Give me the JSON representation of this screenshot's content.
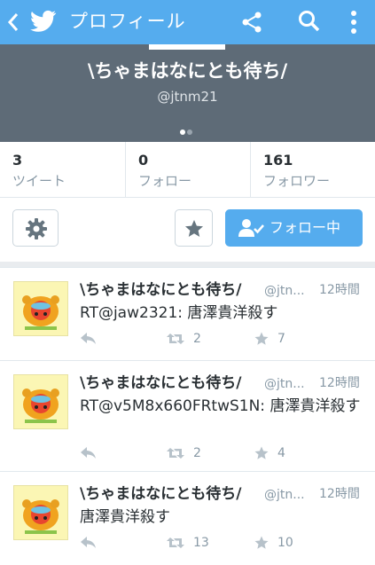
{
  "header": {
    "title": "プロフィール"
  },
  "profile": {
    "name": "\\ちゃまはなにとも待ち/",
    "handle": "@jtnm21"
  },
  "stats": [
    {
      "count": "3",
      "label": "ツイート"
    },
    {
      "count": "0",
      "label": "フォロー"
    },
    {
      "count": "161",
      "label": "フォロワー"
    }
  ],
  "actions": {
    "follow_label": "フォロー中"
  },
  "tweets": [
    {
      "name": "\\ちゃまはなにとも待ち/",
      "handle": "@jtn...",
      "time": "12時間",
      "text": "RT@jaw2321: 唐澤貴洋殺す",
      "retweets": "2",
      "favorites": "7"
    },
    {
      "name": "\\ちゃまはなにとも待ち/",
      "handle": "@jtn...",
      "time": "12時間",
      "text": "RT@v5M8x660FRtwS1N: 唐澤貴洋殺す",
      "retweets": "2",
      "favorites": "4"
    },
    {
      "name": "\\ちゃまはなにとも待ち/",
      "handle": "@jtn...",
      "time": "12時間",
      "text": "唐澤貴洋殺す",
      "retweets": "13",
      "favorites": "10"
    }
  ],
  "colors": {
    "brand": "#55acee",
    "banner": "#5e6b77",
    "muted": "#8899a6",
    "text": "#292f33"
  },
  "icons": {
    "back": "chevron-left-icon",
    "logo": "twitter-bird-icon",
    "share": "share-icon",
    "search": "search-icon",
    "more": "more-vertical-icon",
    "settings": "gear-icon",
    "list": "star-icon",
    "follow": "person-check-icon",
    "reply": "reply-icon",
    "retweet": "retweet-icon",
    "favorite": "star-icon"
  }
}
